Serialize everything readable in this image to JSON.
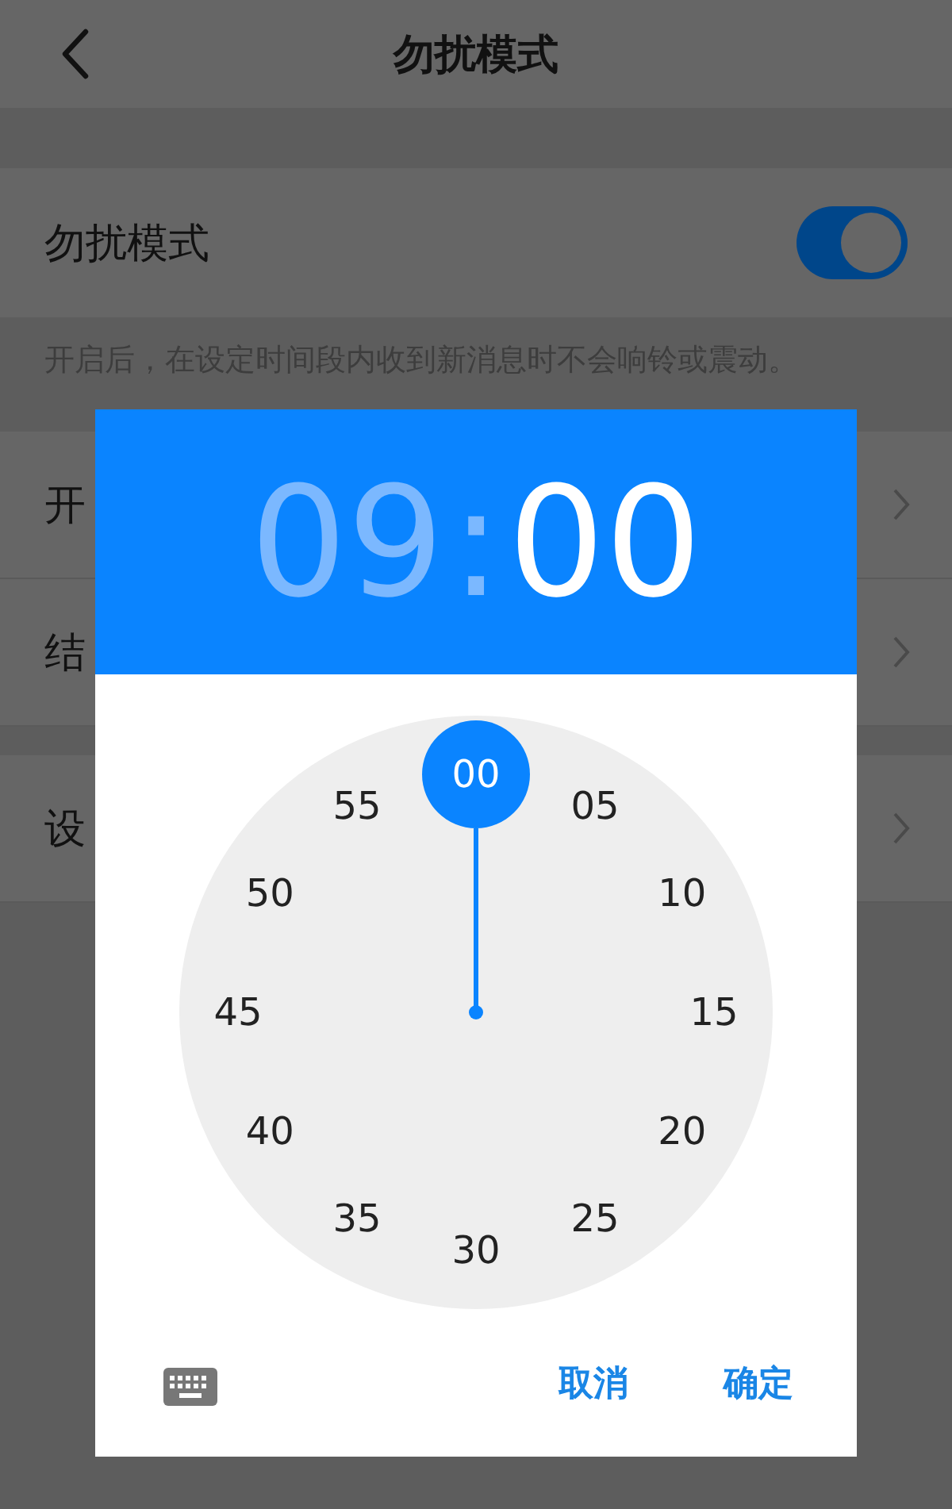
{
  "header": {
    "title": "勿扰模式"
  },
  "dnd": {
    "label": "勿扰模式",
    "on": true
  },
  "description": "开启后，在设定时间段内收到新消息时不会响铃或震动。",
  "time_rows": [
    {
      "label": "开"
    },
    {
      "label": "结"
    }
  ],
  "other_rows": [
    {
      "label": "设"
    }
  ],
  "dialog": {
    "hour": {
      "text": "09",
      "selected": false
    },
    "separator": ":",
    "minute": {
      "text": "00",
      "selected": true
    },
    "dial": [
      {
        "label": "00",
        "selected": true
      },
      {
        "label": "05",
        "selected": false
      },
      {
        "label": "10",
        "selected": false
      },
      {
        "label": "15",
        "selected": false
      },
      {
        "label": "20",
        "selected": false
      },
      {
        "label": "25",
        "selected": false
      },
      {
        "label": "30",
        "selected": false
      },
      {
        "label": "35",
        "selected": false
      },
      {
        "label": "40",
        "selected": false
      },
      {
        "label": "45",
        "selected": false
      },
      {
        "label": "50",
        "selected": false
      },
      {
        "label": "55",
        "selected": false
      }
    ],
    "buttons": [
      "取消",
      "确定"
    ]
  }
}
